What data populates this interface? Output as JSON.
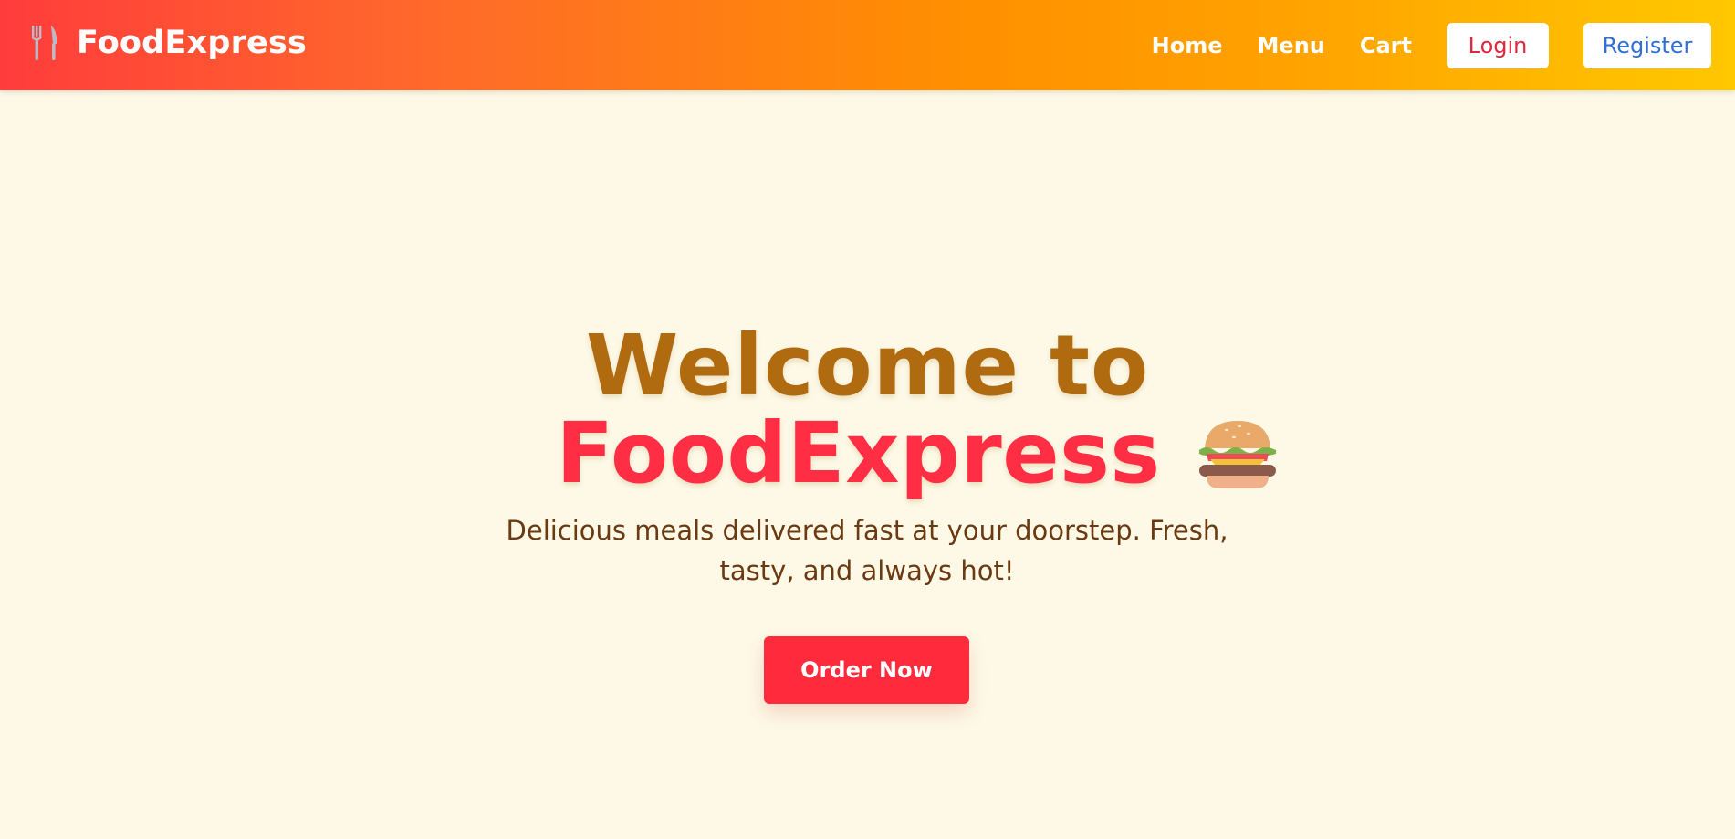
{
  "nav": {
    "brand_icon": "fork-knife-icon",
    "brand": "FoodExpress",
    "links": [
      "Home",
      "Menu",
      "Cart"
    ],
    "login_label": "Login",
    "register_label": "Register"
  },
  "hero": {
    "title_line1": "Welcome to",
    "title_line2": "FoodExpress",
    "title_icon": "burger-icon",
    "tagline": "Delicious meals delivered fast at your doorstep. Fresh, tasty, and always hot!",
    "cta_label": "Order Now"
  },
  "colors": {
    "nav_gradient_start": "#ff3c3c",
    "nav_gradient_end": "#ffc800",
    "background": "#fdf9e6",
    "title_primary": "#b06a10",
    "title_accent": "#ff2e44",
    "tagline": "#6b3a12",
    "cta_background": "#ff2b3c",
    "login_text": "#e0283c",
    "register_text": "#2f6fd6"
  }
}
